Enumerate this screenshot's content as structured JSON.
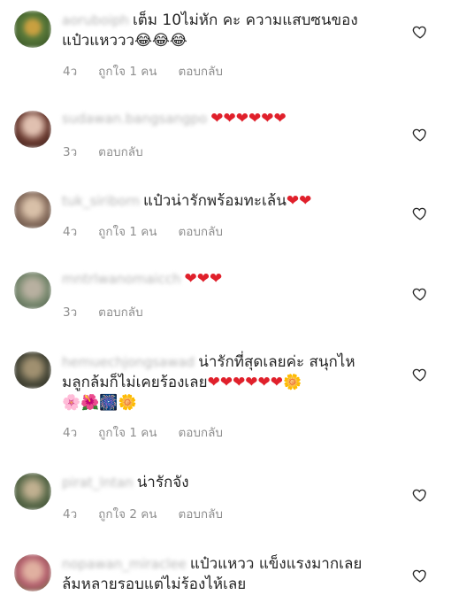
{
  "comments": [
    {
      "username": "aoruboiph",
      "text": "เต็ม 10ไม่หัก คะ ความแสบซนของแป้วแหววว😂😂😂",
      "time": "4ว",
      "likes": "ถูกใจ 1 คน",
      "reply": "ตอบกลับ",
      "avatar_color": "#5a7a3a"
    },
    {
      "username": "sudawan.bangsangpo",
      "text": "❤❤❤❤❤❤",
      "time": "3ว",
      "likes": "",
      "reply": "ตอบกลับ",
      "avatar_color": "#8a5a5a"
    },
    {
      "username": "tuk_siriborn",
      "text": "แป๋วน่ารักพร้อมทะเล้น❤❤",
      "time": "4ว",
      "likes": "ถูกใจ 1 คน",
      "reply": "ตอบกลับ",
      "avatar_color": "#a08878"
    },
    {
      "username": "mntrlwanomaicch",
      "text": "❤❤❤",
      "time": "3ว",
      "likes": "",
      "reply": "ตอบกลับ",
      "avatar_color": "#7a8a7a"
    },
    {
      "username": "hemuechjongsawad",
      "text": "น่ารักที่สุดเลยค่ะ สนุกไหมลูกล้มก็ไม่เคยร้องเลย❤❤❤❤❤❤🌼🌸🌺🎆🌼",
      "time": "4ว",
      "likes": "ถูกใจ 1 คน",
      "reply": "ตอบกลับ",
      "avatar_color": "#4a4a3a"
    },
    {
      "username": "pirat_lntan",
      "text": "น่ารักจัง",
      "time": "4ว",
      "likes": "ถูกใจ 2 คน",
      "reply": "ตอบกลับ",
      "avatar_color": "#5a6a4a"
    },
    {
      "username": "nopawan_miraclee",
      "text": "แป๋วแหวว แข็งแรงมากเลย ล้มหลายรอบแต่ไม่ร้องไห้เลย",
      "time": "",
      "likes": "",
      "reply": "",
      "avatar_color": "#b05a6a"
    }
  ]
}
